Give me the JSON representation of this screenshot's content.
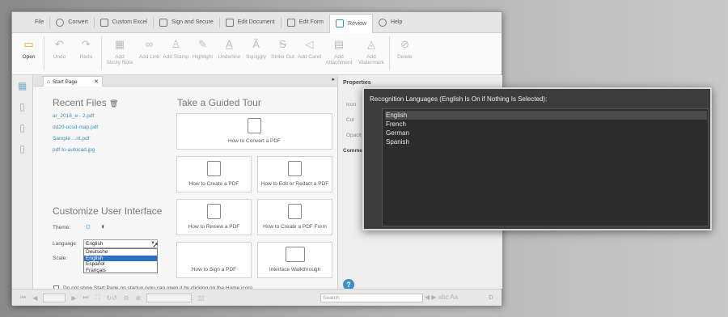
{
  "menu": {
    "items": [
      {
        "label": "File"
      },
      {
        "label": "Convert"
      },
      {
        "label": "Custom Excel"
      },
      {
        "label": "Sign and Secure"
      },
      {
        "label": "Edit Document"
      },
      {
        "label": "Edit Form"
      },
      {
        "label": "Review"
      },
      {
        "label": "Help"
      }
    ]
  },
  "toolbar": {
    "items": [
      {
        "label": "Open",
        "icon": "folder-icon"
      },
      {
        "label": "Undo",
        "icon": "undo-icon"
      },
      {
        "label": "Redo",
        "icon": "redo-icon"
      },
      {
        "label": "Add\nSticky Note",
        "icon": "sticky-note-icon"
      },
      {
        "label": "Add Link",
        "icon": "link-icon"
      },
      {
        "label": "Add Stamp",
        "icon": "stamp-icon"
      },
      {
        "label": "Highlight",
        "icon": "highlight-icon"
      },
      {
        "label": "Underline",
        "icon": "underline-icon"
      },
      {
        "label": "Squiggly",
        "icon": "squiggly-icon"
      },
      {
        "label": "Strike Out",
        "icon": "strikeout-icon"
      },
      {
        "label": "Add Caret",
        "icon": "caret-icon"
      },
      {
        "label": "Add\nAttachment",
        "icon": "attachment-icon"
      },
      {
        "label": "Add\nWatermark",
        "icon": "watermark-icon"
      },
      {
        "label": "Delete",
        "icon": "delete-icon"
      }
    ]
  },
  "tab": {
    "label": "Start Page",
    "close": "✕"
  },
  "recent": {
    "title": "Recent Files",
    "files": [
      "ar_2018_e - 2.pdf",
      "dd20-ucsd-map.pdf",
      "Sample ...nt.pdf",
      "pdf-to-autocad.jpg"
    ]
  },
  "tour": {
    "title": "Take a Guided Tour",
    "cards": [
      "How to Convert a PDF",
      "How to Create a PDF",
      "How to Edit or Redact a PDF",
      "How to Review a PDF",
      "How to Create a PDF Form",
      "How to Sign a PDF",
      "Interface Walkthrough"
    ]
  },
  "customize": {
    "title": "Customize User Interface",
    "theme_label": "Theme:",
    "language_label": "Language:",
    "scale_label": "Scale:",
    "language_value": "English",
    "options": [
      "Deutsche",
      "English",
      "Español",
      "Français"
    ],
    "selected_option": "English"
  },
  "startup": {
    "label": "Do not show Start Page on startup (you can open it by clicking on the Home icon)"
  },
  "status": {
    "search_placeholder": "Search"
  },
  "properties": {
    "title": "Properties",
    "icon_label": "Icon",
    "color_label": "Col",
    "opacity_label": "Opacit",
    "comment_label": "Comme"
  },
  "dialog": {
    "title": "Recognition Languages (English Is On if Nothing Is Selected):",
    "languages": [
      "English",
      "French",
      "German",
      "Spanish"
    ],
    "highlighted": "English"
  },
  "colors": {
    "accent": "#3b8fb5",
    "selection": "#2f6fbf",
    "dialog_bg": "#3c3c3c",
    "help": "#3c8fc8"
  }
}
